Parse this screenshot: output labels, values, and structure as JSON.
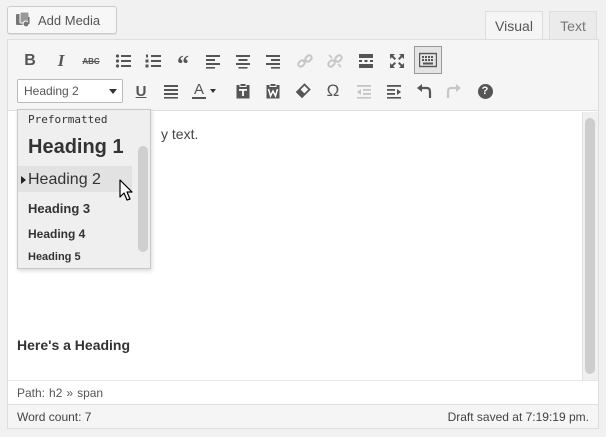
{
  "header": {
    "add_media_label": "Add Media",
    "tabs": [
      {
        "label": "Visual",
        "active": true
      },
      {
        "label": "Text",
        "active": false
      }
    ]
  },
  "toolbar": {
    "row1": [
      "bold-icon",
      "italic-icon",
      "strikethrough-icon",
      "bulleted-list-icon",
      "numbered-list-icon",
      "blockquote-icon",
      "align-left-icon",
      "align-center-icon",
      "align-right-icon",
      "insert-link-icon",
      "remove-link-icon",
      "read-more-icon",
      "fullscreen-icon",
      "toolbar-toggle-icon"
    ],
    "row2": [
      "underline-icon",
      "justify-icon",
      "text-color-icon",
      "paste-as-text-icon",
      "paste-from-word-icon",
      "clear-formatting-icon",
      "special-character-icon",
      "outdent-icon",
      "indent-icon",
      "undo-icon",
      "redo-icon",
      "help-icon"
    ],
    "format_select_value": "Heading 2",
    "text_color_letter": "A",
    "special_char_symbol": "Ω",
    "bold_letter": "B",
    "italic_letter": "I",
    "underline_letter": "U",
    "strike_letters": "ABC",
    "help_symbol": "?"
  },
  "format_dropdown": {
    "items": [
      "Preformatted",
      "Heading 1",
      "Heading 2",
      "Heading 3",
      "Heading 4",
      "Heading 5"
    ],
    "selected": "Heading 2"
  },
  "content": {
    "paragraph_visible_text": "y text.",
    "heading_text": "Here's a Heading"
  },
  "path": {
    "label": "Path:",
    "segments": [
      "h2",
      "»",
      "span"
    ]
  },
  "status": {
    "word_count": "Word count: 7",
    "draft_saved": "Draft saved at 7:19:19 pm."
  },
  "colors": {
    "toolbar_bg": "#f5f5f5",
    "border": "#dedede",
    "icon": "#555555",
    "icon_disabled": "#c6c6c6"
  }
}
